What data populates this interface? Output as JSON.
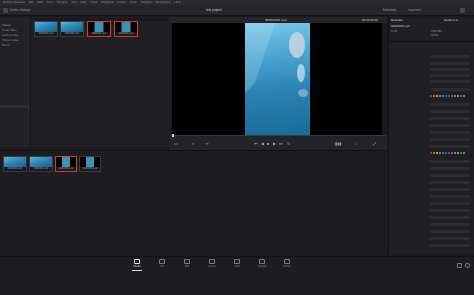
{
  "menubar": {
    "items": [
      "DaVinci Resolve",
      "File",
      "Edit",
      "Trim",
      "Timeline",
      "Clip",
      "Mark",
      "View",
      "Playback",
      "Fusion",
      "Color",
      "Fairlight",
      "Workspace",
      "Help"
    ]
  },
  "project": {
    "title": "test project"
  },
  "header": {
    "media_storage": "Media Storage",
    "metadata": "Metadata",
    "inspector": "Inspector",
    "metadata_tab": "Media Pool"
  },
  "viewer": {
    "clip_name": "000000000.mp4",
    "timecode": "00:00:00:00"
  },
  "bins": {
    "clips": [
      "0000000.mp4",
      "0000000.mp4",
      "0000000.mp4",
      "0000000.mp4"
    ]
  },
  "mediapool": {
    "clips": [
      "0000000.mp4",
      "0000000.mp4",
      "0000000.mp4",
      "0000000.mp4"
    ]
  },
  "inspector": {
    "file_name": "000000000.mp4",
    "codec": "H.264",
    "resolution": "720x1280",
    "fps": "30.000",
    "dur": "00:00:10:00"
  },
  "leftpanel": {
    "items": [
      "Master",
      "Smart Bins",
      "Audio Folder",
      "Video Folder",
      "Music"
    ]
  },
  "pages": [
    {
      "label": "Media",
      "icon": "media-page-icon"
    },
    {
      "label": "Cut",
      "icon": "cut-page-icon"
    },
    {
      "label": "Edit",
      "icon": "edit-page-icon"
    },
    {
      "label": "Fusion",
      "icon": "fusion-page-icon"
    },
    {
      "label": "Color",
      "icon": "color-page-icon"
    },
    {
      "label": "Fairlight",
      "icon": "fairlight-page-icon"
    },
    {
      "label": "Deliver",
      "icon": "deliver-page-icon"
    }
  ],
  "colors": {
    "accent": "#d23b3b",
    "bg": "#1b1b1e"
  }
}
